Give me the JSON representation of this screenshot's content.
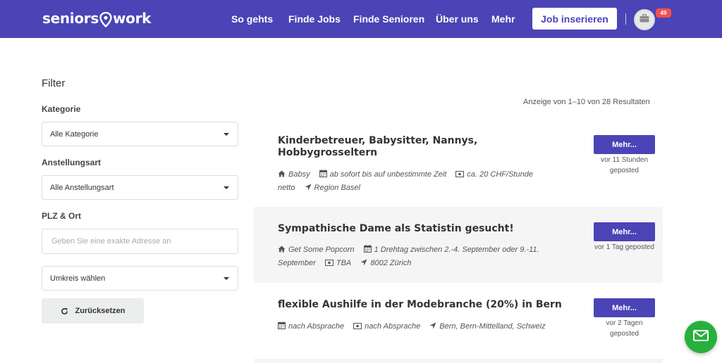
{
  "header": {
    "logo_left": "seniors",
    "logo_right": "work",
    "nav": [
      "So gehts",
      "Finde Jobs",
      "Finde Senioren",
      "Über uns",
      "Mehr"
    ],
    "post_job_label": "Job inserieren",
    "notification_count": "49",
    "colors": {
      "brand": "#4a44b6",
      "badge": "#f24f4f"
    }
  },
  "filter": {
    "title": "Filter",
    "category_label": "Kategorie",
    "category_value": "Alle Kategorie",
    "employment_label": "Anstellungsart",
    "employment_value": "Alle Anstellungsart",
    "location_label": "PLZ & Ort",
    "location_placeholder": "Geben Sie eine exakte Adresse an",
    "location_value": "",
    "radius_value": "Umkreis wählen",
    "reset_label": "Zurücksetzen"
  },
  "results": {
    "count_text": "Anzeige von 1–10 von 28 Resultaten",
    "jobs": [
      {
        "title": "Kinderbetreuer, Babysitter, Nannys, Hobbygrosseltern",
        "company": "Babsy",
        "date": "ab sofort bis auf unbestimmte Zeit",
        "pay": "ca. 20 CHF/Stunde netto",
        "location": "Region Basel",
        "button": "Mehr...",
        "posted": "vor 11 Stunden geposted"
      },
      {
        "title": "Sympathische Dame als Statistin gesucht!",
        "company": "Get Some Popcorn",
        "date": "1 Drehtag zwischen 2.-4. September oder 9.-11. September",
        "pay": "TBA",
        "location": "8002 Zürich",
        "button": "Mehr...",
        "posted": "vor 1 Tag geposted"
      },
      {
        "title": "flexible Aushilfe in der Modebranche (20%) in Bern",
        "date": "nach Absprache",
        "pay": "nach Absprache",
        "location": "Bern, Bern-Mittelland, Schweiz",
        "button": "Mehr...",
        "posted": "vor 2 Tagen geposted"
      }
    ]
  },
  "chat": {
    "icon": "mail-icon",
    "color": "#27b13c"
  }
}
